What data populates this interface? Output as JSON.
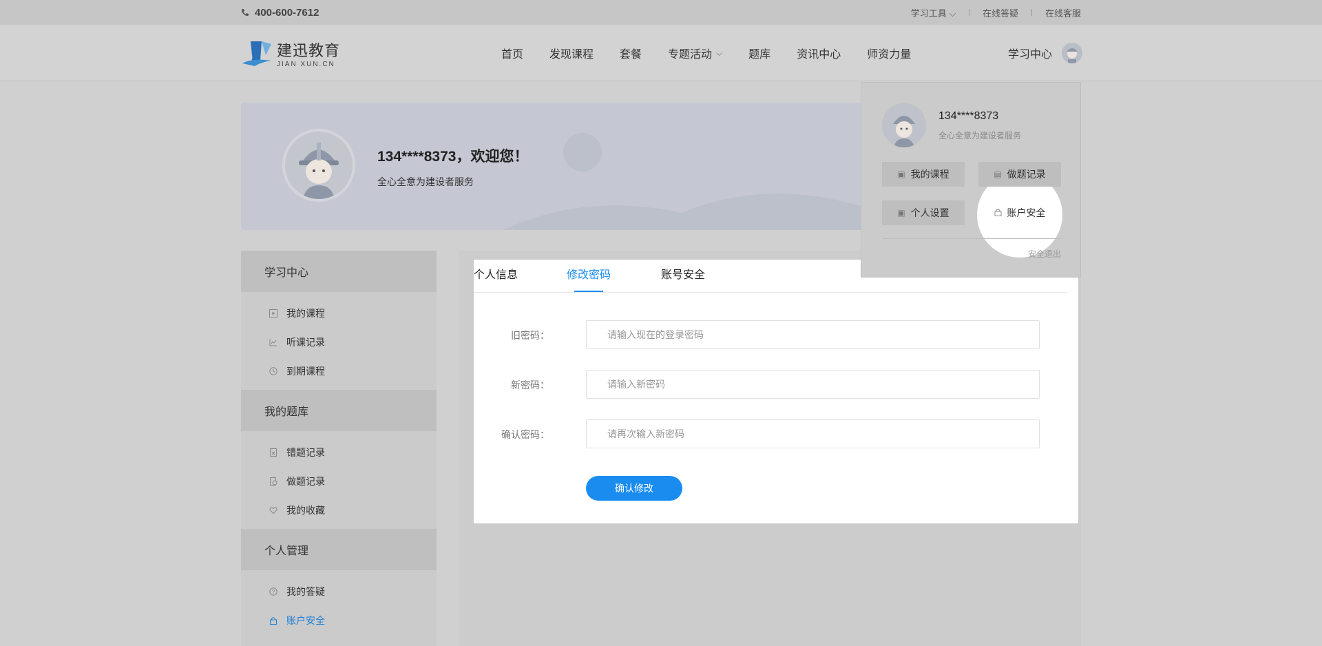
{
  "topbar": {
    "phone": "400-600-7612",
    "links": [
      "学习工具",
      "在线答疑",
      "在线客服"
    ]
  },
  "header": {
    "logo_cn": "建迅教育",
    "logo_en": "JIAN XUN.CN",
    "nav": [
      "首页",
      "发现课程",
      "套餐",
      "专题活动",
      "题库",
      "资讯中心",
      "师资力量"
    ],
    "study_center": "学习中心"
  },
  "banner": {
    "greeting": "134****8373，欢迎您！",
    "subtitle": "全心全意为建设者服务"
  },
  "sidebar": {
    "groups": [
      {
        "title": "学习中心",
        "items": [
          "我的课程",
          "听课记录",
          "到期课程"
        ]
      },
      {
        "title": "我的题库",
        "items": [
          "错题记录",
          "做题记录",
          "我的收藏"
        ]
      },
      {
        "title": "个人管理",
        "items": [
          "我的答疑",
          "账户安全"
        ]
      }
    ],
    "active_item": "账户安全"
  },
  "tabs": {
    "items": [
      "个人信息",
      "修改密码",
      "账号安全"
    ],
    "active": "修改密码"
  },
  "form": {
    "old_label": "旧密码：",
    "old_placeholder": "请输入现在的登录密码",
    "new_label": "新密码：",
    "new_placeholder": "请输入新密码",
    "confirm_label": "确认密码：",
    "confirm_placeholder": "请再次输入新密码",
    "submit_label": "确认修改"
  },
  "dropdown": {
    "name": "134****8373",
    "subtitle": "全心全意为建设者服务",
    "buttons": [
      "我的课程",
      "做题记录",
      "个人设置",
      "账户安全"
    ],
    "logout": "安全退出"
  },
  "colors": {
    "accent": "#1a8cf0",
    "overlay": "#cccccc"
  }
}
